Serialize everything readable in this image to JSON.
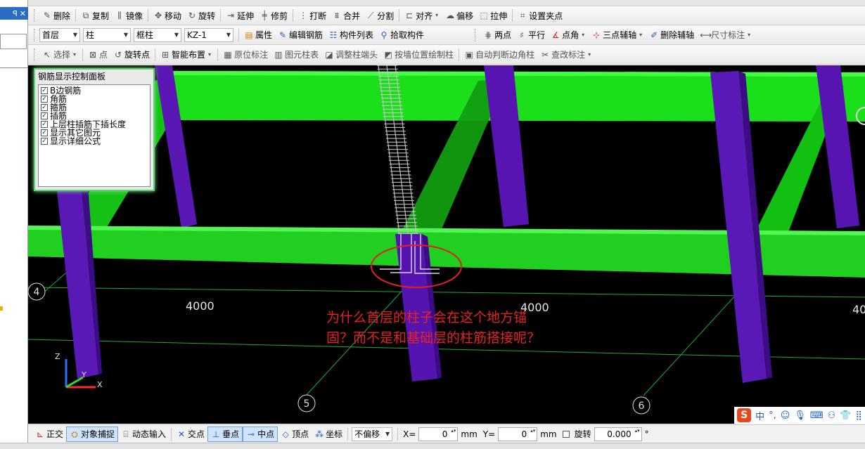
{
  "sidebar": {
    "pin_label": "ꟼ",
    "close_label": "✕"
  },
  "toolbar1": {
    "delete": "删除",
    "copy": "复制",
    "mirror": "镜像",
    "move": "移动",
    "rotate": "旋转",
    "extend": "延伸",
    "trim": "修剪",
    "break": "打断",
    "merge": "合并",
    "split": "分割",
    "align": "对齐",
    "offset": "偏移",
    "stretch": "拉伸",
    "set_grip": "设置夹点"
  },
  "toolbar2": {
    "floor": "首层",
    "category": "柱",
    "type": "框柱",
    "component": "KZ-1",
    "properties": "属性",
    "edit_rebar": "编辑钢筋",
    "component_list": "构件列表",
    "pick_component": "拾取构件",
    "two_points": "两点",
    "parallel": "平行",
    "point_angle": "点角",
    "three_point_axis": "三点辅轴",
    "delete_axis": "删除辅轴",
    "dimension": "尺寸标注"
  },
  "toolbar3": {
    "select": "选择",
    "point": "点",
    "rotate_point": "旋转点",
    "smart_layout": "智能布置",
    "original_label": "原位标注",
    "element_table": "图元柱表",
    "adjust_column_end": "调整柱端头",
    "draw_by_wall": "按墙位置绘制柱",
    "auto_corner": "自动判断边角柱",
    "check_label": "查改标注"
  },
  "rebar_panel": {
    "title": "钢筋显示控制面板",
    "items": [
      "B边钢筋",
      "角筋",
      "箍筋",
      "插筋",
      "上层柱插筋下插长度",
      "显示其它图元",
      "显示详细公式"
    ]
  },
  "viewport": {
    "dims": [
      "4000",
      "4000",
      "40"
    ],
    "axes": [
      "4",
      "5",
      "6"
    ],
    "axis_letters": {
      "z": "Z",
      "y": "Y",
      "x": "X"
    },
    "question": "为什么首层的柱子会在这个地方锚固？而不是和基础层的柱筋搭接呢？"
  },
  "ime": {
    "logo": "S",
    "lang": "中",
    "punct": "°,"
  },
  "statusbar": {
    "ortho": "正交",
    "object_snap": "对象捕捉",
    "dynamic_input": "动态输入",
    "intersection": "交点",
    "perpendicular": "垂点",
    "midpoint": "中点",
    "vertex": "顶点",
    "coordinate": "坐标",
    "offset_mode": "不偏移",
    "x_label": "X=",
    "x_value": "0",
    "unit": "mm",
    "y_label": "Y=",
    "y_value": "0",
    "rotate_label": "旋转",
    "rotate_value": "0.000",
    "degree": "°"
  }
}
